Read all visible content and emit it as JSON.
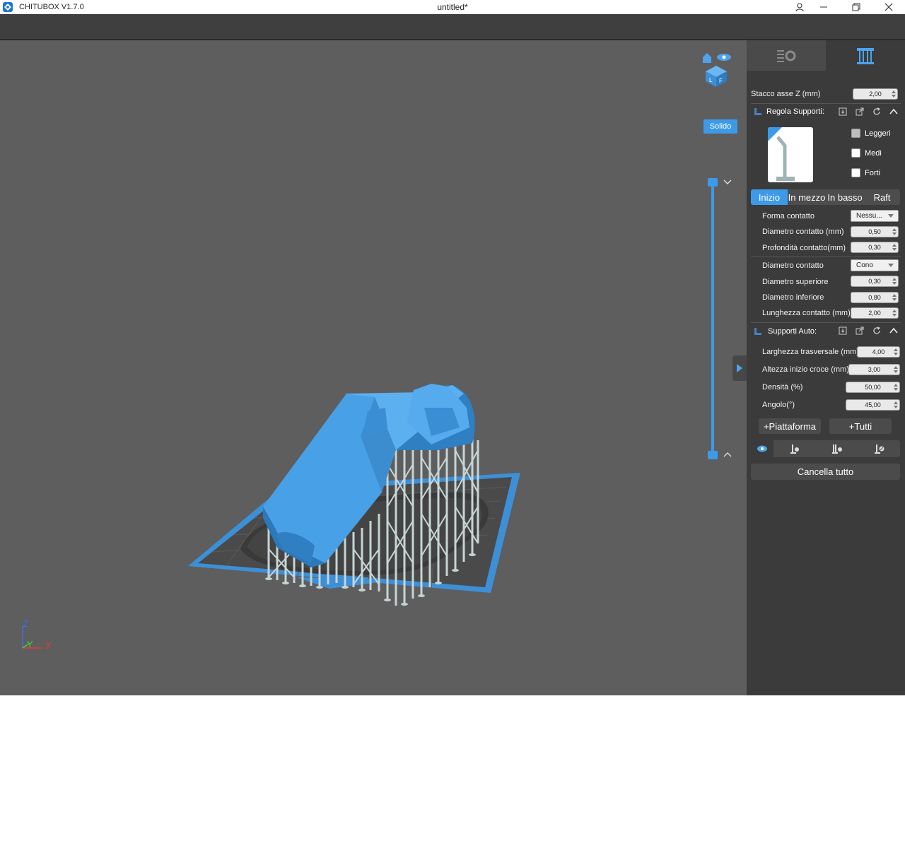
{
  "app": {
    "title": "CHITUBOX V1.7.0",
    "document": "untitled*"
  },
  "viewport": {
    "render_mode": "Solido",
    "axes": {
      "z": "Z",
      "y": "Y",
      "x": "X"
    }
  },
  "panel": {
    "tabs": [
      {
        "icon": "print-settings-icon",
        "active": false
      },
      {
        "icon": "supports-icon",
        "active": true
      }
    ],
    "z_lift_label": "Stacco asse Z (mm)",
    "z_lift_value": "2,00",
    "adjust_supports_title": "Regola Supporti:",
    "presets": [
      "Leggeri",
      "Medi",
      "Forti"
    ],
    "subtabs": [
      "Inizio",
      "In mezzo",
      "In basso",
      "Raft"
    ],
    "active_subtab": "Inizio",
    "contact_params": [
      {
        "label": "Forma contatto",
        "value": "Nessu...",
        "kind": "combo"
      },
      {
        "label": "Diametro contatto (mm)",
        "value": "0,50",
        "kind": "spin"
      },
      {
        "label": "Profondità contatto(mm)",
        "value": "0,30",
        "kind": "spin"
      }
    ],
    "tip_params": [
      {
        "label": "Diametro contatto",
        "value": "Cono",
        "kind": "combo"
      },
      {
        "label": "Diametro superiore",
        "value": "0,30",
        "kind": "spin"
      },
      {
        "label": "Diametro inferiore",
        "value": "0,80",
        "kind": "spin"
      },
      {
        "label": "Lunghezza contatto (mm)",
        "value": "2,00",
        "kind": "spin"
      }
    ],
    "auto_supports_title": "Supporti Auto:",
    "auto_params": [
      {
        "label": "Larghezza trasversale (mm)",
        "value": "4,00"
      },
      {
        "label": "Altezza inizio croce (mm)",
        "value": "3,00"
      },
      {
        "label": "Densità (%)",
        "value": "50,00"
      },
      {
        "label": "Angolo(°)",
        "value": "45,00"
      }
    ],
    "add_platform": "+Piattaforma",
    "add_all": "+Tutti",
    "clear_all": "Cancella tutto"
  },
  "colors": {
    "accent": "#3d9ae8",
    "model": "#48a0e6",
    "supports": "#c6d4d4",
    "viewport_bg": "#5e5e5e",
    "panel_bg": "#3b3b3b"
  }
}
